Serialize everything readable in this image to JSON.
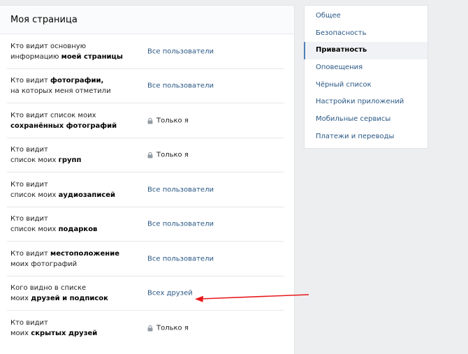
{
  "page": {
    "title": "Моя страница"
  },
  "privacy_rows": [
    {
      "label_parts": [
        {
          "t": "Кто видит основную",
          "b": false
        },
        {
          "t": "\n",
          "b": false
        },
        {
          "t": "информацию ",
          "b": false
        },
        {
          "t": "моей страницы",
          "b": true
        }
      ],
      "value": "Все пользователи",
      "locked": false
    },
    {
      "label_parts": [
        {
          "t": "Кто видит ",
          "b": false
        },
        {
          "t": "фотографии,",
          "b": true
        },
        {
          "t": "\n",
          "b": false
        },
        {
          "t": "на которых меня отметили",
          "b": false
        }
      ],
      "value": "Все пользователи",
      "locked": false
    },
    {
      "label_parts": [
        {
          "t": "Кто видит список моих",
          "b": false
        },
        {
          "t": "\n",
          "b": false
        },
        {
          "t": "сохранённых фотографий",
          "b": true
        }
      ],
      "value": "Только я",
      "locked": true
    },
    {
      "label_parts": [
        {
          "t": "Кто видит",
          "b": false
        },
        {
          "t": "\n",
          "b": false
        },
        {
          "t": "список моих ",
          "b": false
        },
        {
          "t": "групп",
          "b": true
        }
      ],
      "value": "Только я",
      "locked": true
    },
    {
      "label_parts": [
        {
          "t": "Кто видит",
          "b": false
        },
        {
          "t": "\n",
          "b": false
        },
        {
          "t": "список моих ",
          "b": false
        },
        {
          "t": "аудиозаписей",
          "b": true
        }
      ],
      "value": "Все пользователи",
      "locked": false
    },
    {
      "label_parts": [
        {
          "t": "Кто видит",
          "b": false
        },
        {
          "t": "\n",
          "b": false
        },
        {
          "t": "список моих ",
          "b": false
        },
        {
          "t": "подарков",
          "b": true
        }
      ],
      "value": "Все пользователи",
      "locked": false
    },
    {
      "label_parts": [
        {
          "t": "Кто видит ",
          "b": false
        },
        {
          "t": "местоположение",
          "b": true
        },
        {
          "t": "\n",
          "b": false
        },
        {
          "t": "моих фотографий",
          "b": false
        }
      ],
      "value": "Все пользователи",
      "locked": false
    },
    {
      "label_parts": [
        {
          "t": "Кого видно в списке",
          "b": false
        },
        {
          "t": "\n",
          "b": false
        },
        {
          "t": "моих ",
          "b": false
        },
        {
          "t": "друзей и подписок",
          "b": true
        }
      ],
      "value": "Всех друзей",
      "locked": false
    },
    {
      "label_parts": [
        {
          "t": "Кто видит",
          "b": false
        },
        {
          "t": "\n",
          "b": false
        },
        {
          "t": "моих ",
          "b": false
        },
        {
          "t": "скрытых друзей",
          "b": true
        }
      ],
      "value": "Только я",
      "locked": true
    }
  ],
  "side_menu": {
    "items": [
      {
        "label": "Общее",
        "active": false
      },
      {
        "label": "Безопасность",
        "active": false
      },
      {
        "label": "Приватность",
        "active": true
      },
      {
        "label": "Оповещения",
        "active": false
      },
      {
        "label": "Чёрный список",
        "active": false
      },
      {
        "label": "Настройки приложений",
        "active": false
      },
      {
        "label": "Мобильные сервисы",
        "active": false
      },
      {
        "label": "Платежи и переводы",
        "active": false
      }
    ]
  },
  "colors": {
    "link": "#2a5885",
    "accent": "#5181b8",
    "arrow": "#e8191b",
    "background": "#edeef0"
  },
  "icons": {
    "lock": "lock-icon",
    "arrow": "red-arrow-icon"
  }
}
